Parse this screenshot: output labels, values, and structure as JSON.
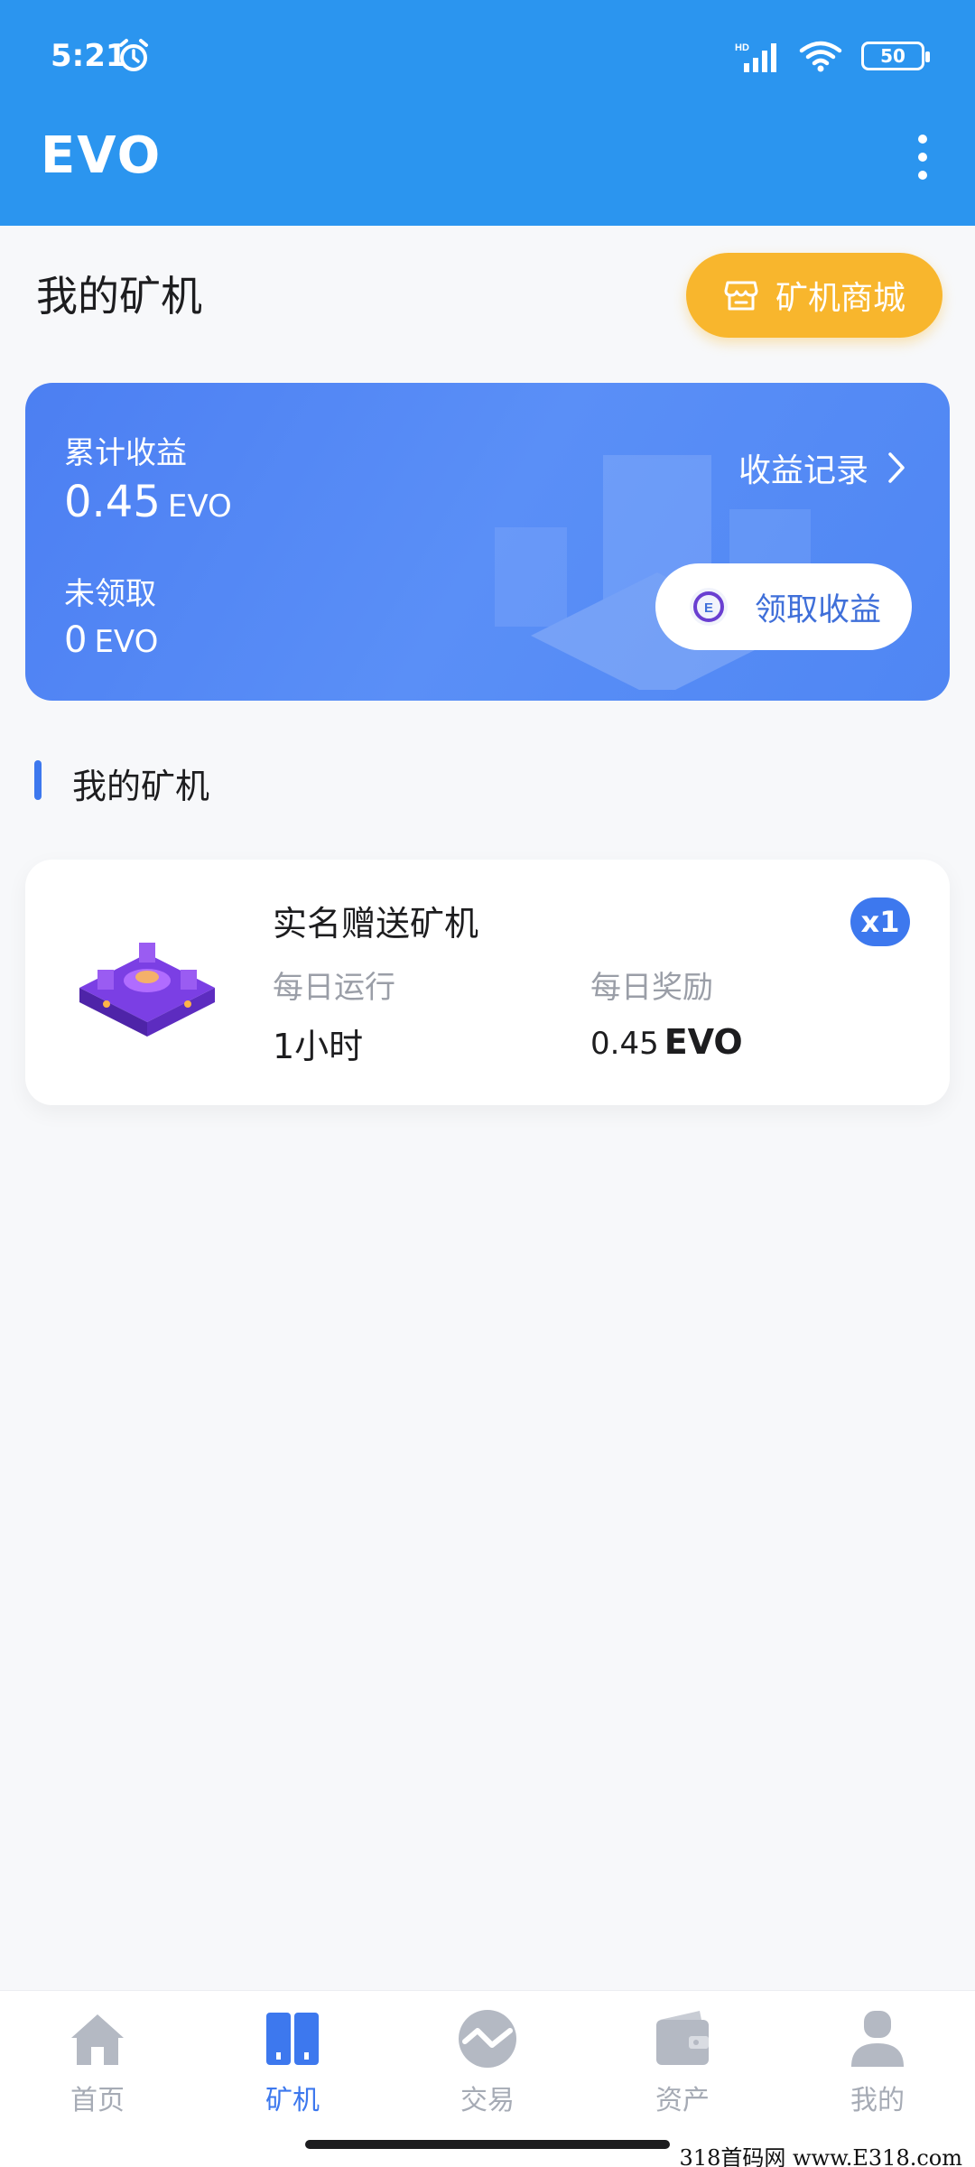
{
  "status_bar": {
    "time": "5:21",
    "battery": "50"
  },
  "header": {
    "title": "EVO"
  },
  "page": {
    "title": "我的矿机",
    "shop_button": "矿机商城"
  },
  "earnings": {
    "total_label": "累计收益",
    "total_value": "0.45",
    "total_unit": "EVO",
    "unclaimed_label": "未领取",
    "unclaimed_value": "0",
    "unclaimed_unit": "EVO",
    "record_link": "收益记录",
    "claim_button": "领取收益"
  },
  "section": {
    "title": "我的矿机"
  },
  "miner": {
    "name": "实名赠送矿机",
    "count": "x1",
    "run_label": "每日运行",
    "run_value": "1小时",
    "reward_label": "每日奖励",
    "reward_value": "0.45",
    "reward_unit": "EVO"
  },
  "nav": {
    "items": [
      {
        "label": "首页",
        "icon": "home-icon"
      },
      {
        "label": "矿机",
        "icon": "miner-icon"
      },
      {
        "label": "交易",
        "icon": "trade-icon"
      },
      {
        "label": "资产",
        "icon": "wallet-icon"
      },
      {
        "label": "我的",
        "icon": "user-icon"
      }
    ],
    "active_index": 1
  },
  "watermark": "318首码网 www.E318.com",
  "colors": {
    "header": "#2b95ef",
    "accent": "#3d78ee",
    "shop_button": "#f8b62d",
    "card": "#4f86f3"
  }
}
